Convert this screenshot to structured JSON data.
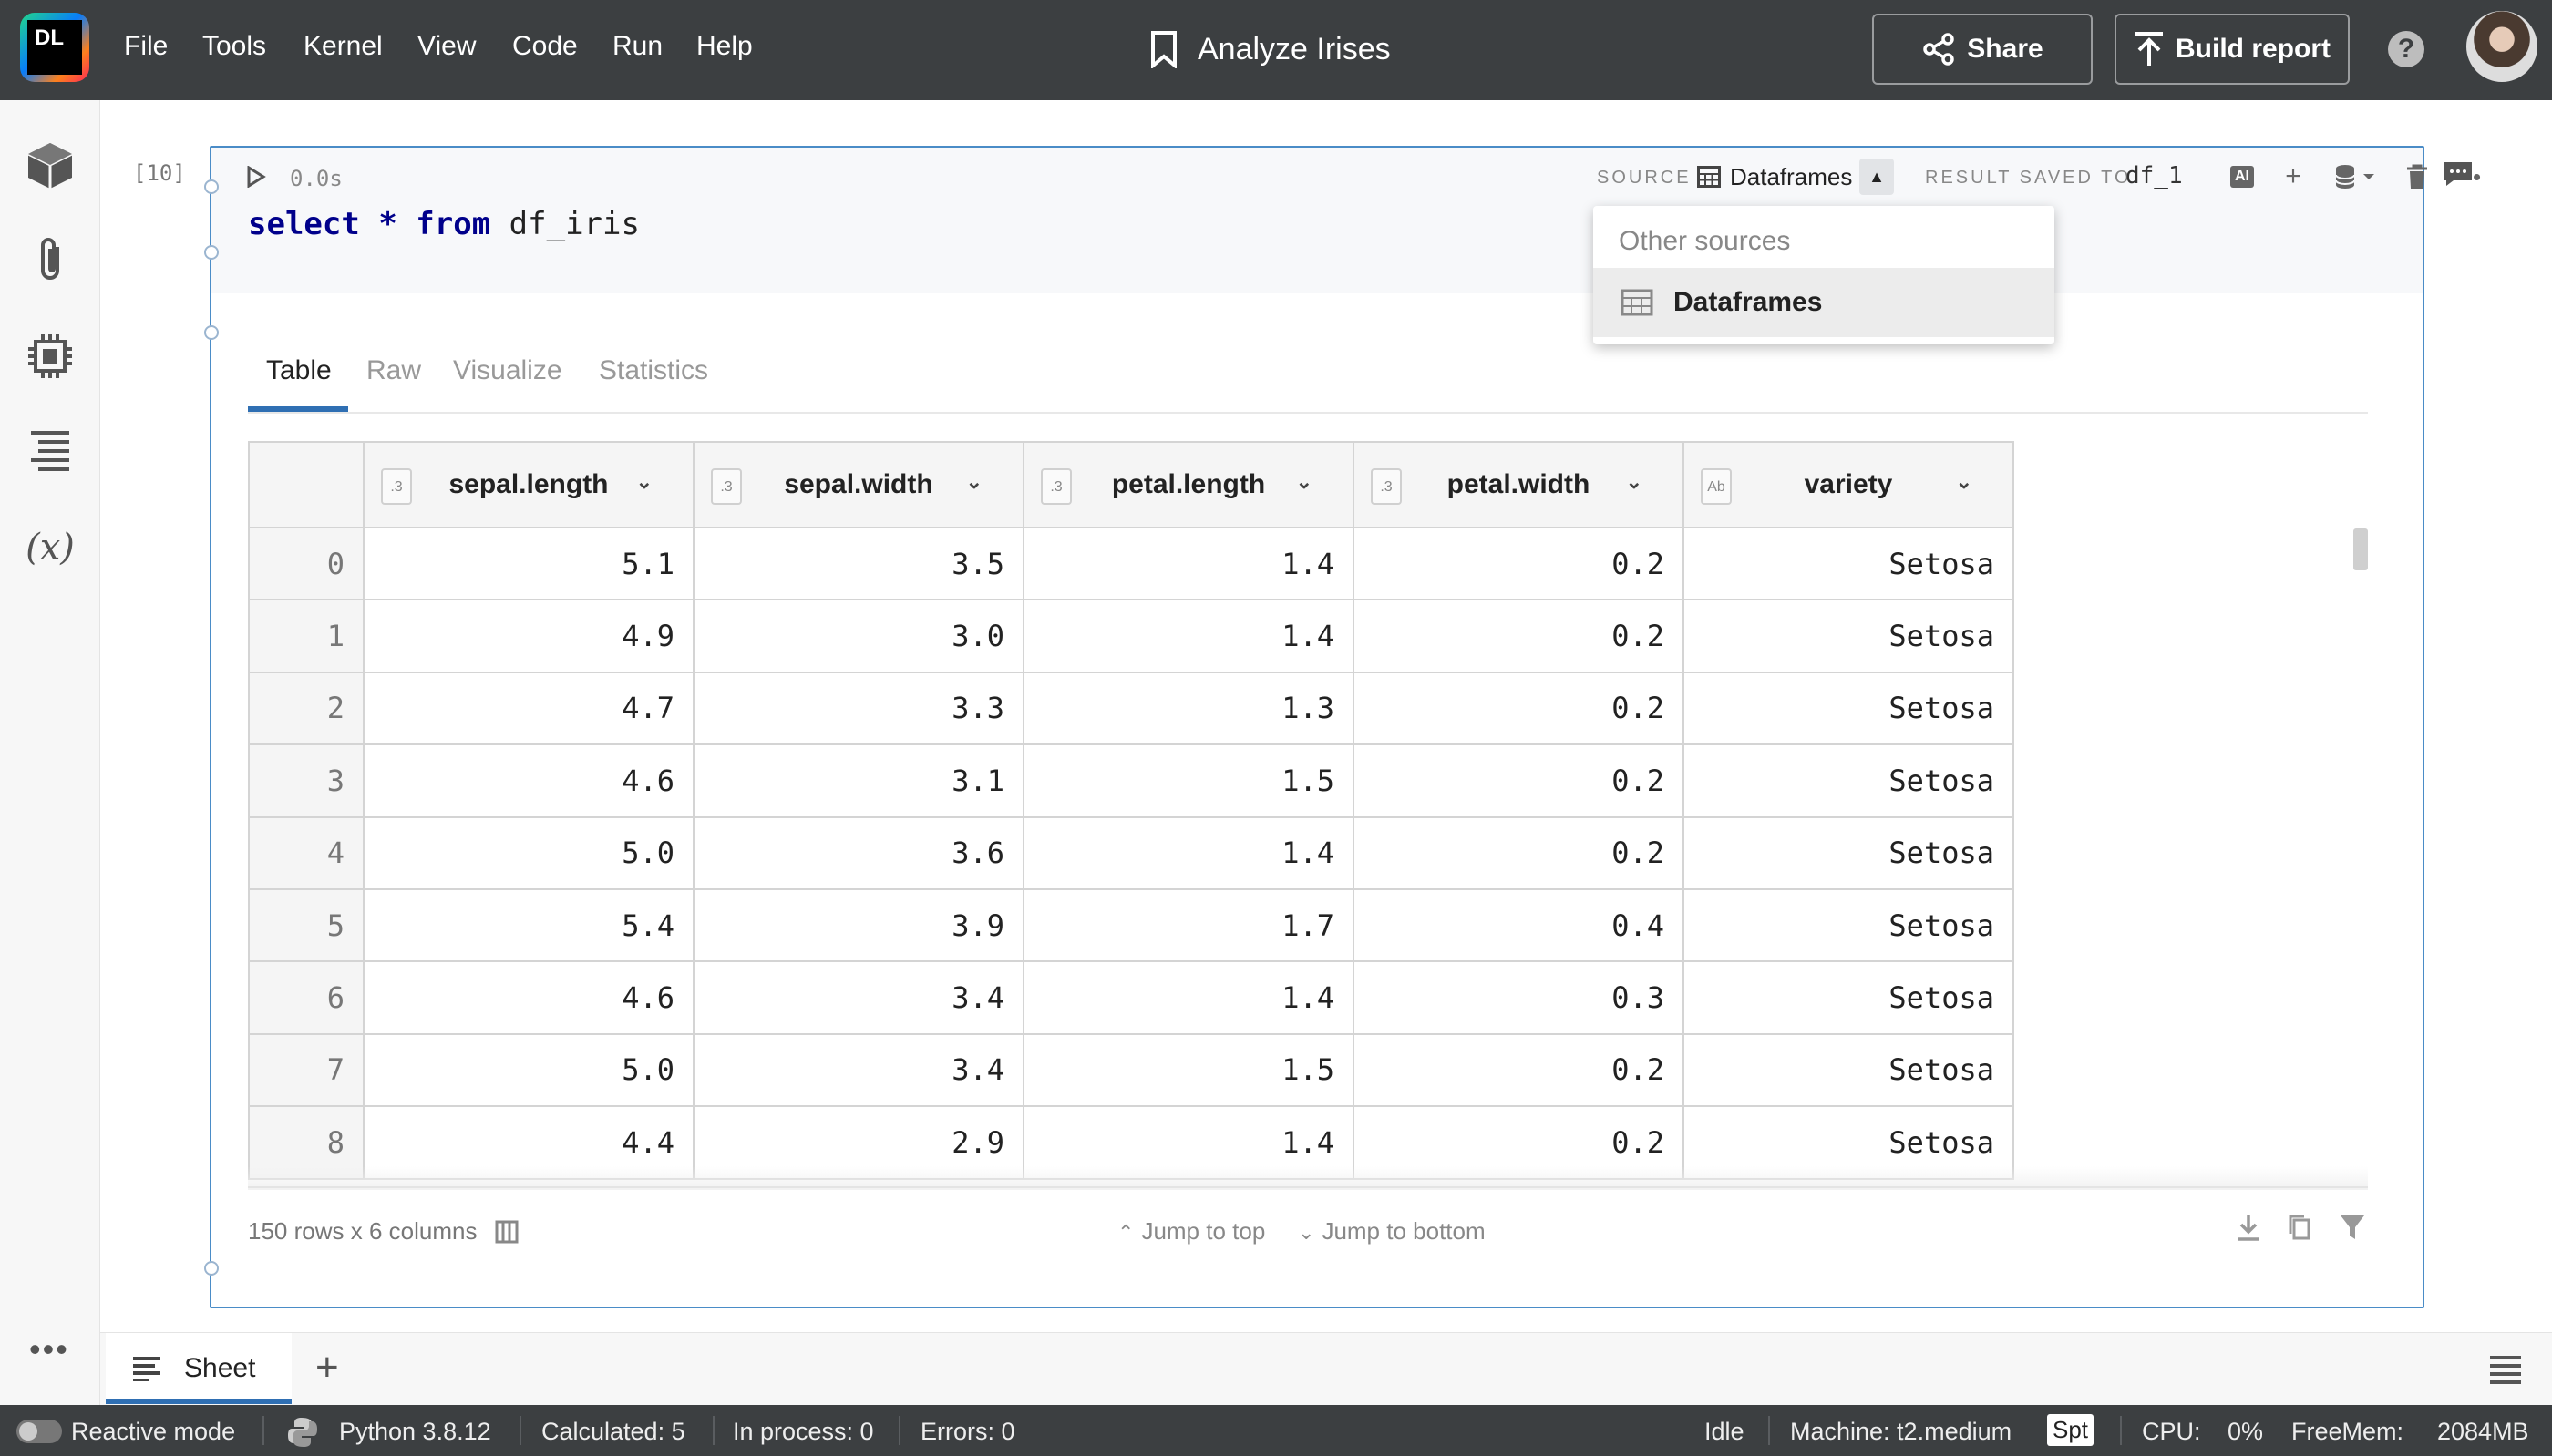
{
  "menu": [
    "File",
    "Tools",
    "Kernel",
    "View",
    "Code",
    "Run",
    "Help"
  ],
  "logo_text": "DL",
  "notebook_title": "Analyze Irises",
  "share_label": "Share",
  "build_report_label": "Build report",
  "help_label": "?",
  "cell": {
    "number": "[10]",
    "exec_time": "0.0s",
    "code_kw1": "select",
    "code_star": "*",
    "code_kw2": "from",
    "code_table": "df_iris",
    "source_label": "SOURCE",
    "source_value": "Dataframes",
    "result_label": "RESULT SAVED TO",
    "result_value": "df_1",
    "ai_label": "AI"
  },
  "dropdown": {
    "header": "Other sources",
    "item": "Dataframes"
  },
  "tabs": [
    "Table",
    "Raw",
    "Visualize",
    "Statistics"
  ],
  "columns": [
    {
      "name": "sepal.length",
      "type": ".3"
    },
    {
      "name": "sepal.width",
      "type": ".3"
    },
    {
      "name": "petal.length",
      "type": ".3"
    },
    {
      "name": "petal.width",
      "type": ".3"
    },
    {
      "name": "variety",
      "type": "Ab"
    }
  ],
  "rows": [
    [
      "0",
      "5.1",
      "3.5",
      "1.4",
      "0.2",
      "Setosa"
    ],
    [
      "1",
      "4.9",
      "3.0",
      "1.4",
      "0.2",
      "Setosa"
    ],
    [
      "2",
      "4.7",
      "3.3",
      "1.3",
      "0.2",
      "Setosa"
    ],
    [
      "3",
      "4.6",
      "3.1",
      "1.5",
      "0.2",
      "Setosa"
    ],
    [
      "4",
      "5.0",
      "3.6",
      "1.4",
      "0.2",
      "Setosa"
    ],
    [
      "5",
      "5.4",
      "3.9",
      "1.7",
      "0.4",
      "Setosa"
    ],
    [
      "6",
      "4.6",
      "3.4",
      "1.4",
      "0.3",
      "Setosa"
    ],
    [
      "7",
      "5.0",
      "3.4",
      "1.5",
      "0.2",
      "Setosa"
    ],
    [
      "8",
      "4.4",
      "2.9",
      "1.4",
      "0.2",
      "Setosa"
    ]
  ],
  "footer": {
    "row_info": "150 rows x 6 columns",
    "jump_top": "Jump to top",
    "jump_bottom": "Jump to bottom"
  },
  "sheet": {
    "tab_label": "Sheet",
    "add_label": "+"
  },
  "status": {
    "reactive": "Reactive mode",
    "python": "Python 3.8.12",
    "calculated": "Calculated: 5",
    "in_process": "In process: 0",
    "errors": "Errors: 0",
    "state": "Idle",
    "machine": "Machine: t2.medium",
    "spt": "Spt",
    "cpu_label": "CPU:",
    "cpu_value": "0%",
    "freemem_label": "FreeMem:",
    "freemem_value": "2084MB"
  }
}
